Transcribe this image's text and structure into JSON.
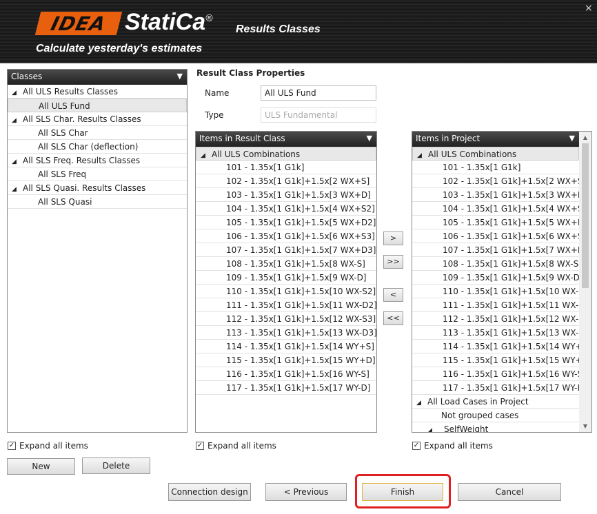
{
  "header": {
    "logo": "IDEA",
    "brand": "StatiCa",
    "reg": "®",
    "subtitle": "Results Classes",
    "tagline": "Calculate yesterday's estimates",
    "close": "×"
  },
  "classes": {
    "title": "Classes",
    "items": [
      {
        "label": "All ULS Results Classes",
        "group": true
      },
      {
        "label": "All ULS Fund",
        "group": false,
        "selected": true
      },
      {
        "label": "All SLS Char. Results Classes",
        "group": true
      },
      {
        "label": "All SLS Char",
        "group": false
      },
      {
        "label": "All SLS Char (deflection)",
        "group": false
      },
      {
        "label": "All SLS Freq. Results Classes",
        "group": true
      },
      {
        "label": "All SLS Freq",
        "group": false
      },
      {
        "label": "All SLS Quasi. Results Classes",
        "group": true
      },
      {
        "label": "All SLS Quasi",
        "group": false
      }
    ]
  },
  "properties": {
    "title": "Result Class Properties",
    "name_label": "Name",
    "name_value": "All ULS Fund",
    "type_label": "Type",
    "type_value": "ULS Fundamental"
  },
  "in_class": {
    "title": "Items in Result Class",
    "group": "All ULS Combinations"
  },
  "in_project": {
    "title": "Items in Project",
    "group": "All ULS Combinations",
    "group2": "All Load Cases in Project",
    "not_grouped": "Not grouped cases",
    "selfweight": "SelfWeight"
  },
  "combinations": [
    "101 - 1.35x[1 G1k]",
    "102 - 1.35x[1 G1k]+1.5x[2 WX+S]",
    "103 - 1.35x[1 G1k]+1.5x[3 WX+D]",
    "104 - 1.35x[1 G1k]+1.5x[4 WX+S2]",
    "105 - 1.35x[1 G1k]+1.5x[5 WX+D2]",
    "106 - 1.35x[1 G1k]+1.5x[6 WX+S3]",
    "107 - 1.35x[1 G1k]+1.5x[7 WX+D3]",
    "108 - 1.35x[1 G1k]+1.5x[8 WX-S]",
    "109 - 1.35x[1 G1k]+1.5x[9 WX-D]",
    "110 - 1.35x[1 G1k]+1.5x[10 WX-S2]",
    "111 - 1.35x[1 G1k]+1.5x[11 WX-D2]",
    "112 - 1.35x[1 G1k]+1.5x[12 WX-S3]",
    "113 - 1.35x[1 G1k]+1.5x[13 WX-D3]",
    "114 - 1.35x[1 G1k]+1.5x[14 WY+S]",
    "115 - 1.35x[1 G1k]+1.5x[15 WY+D]",
    "116 - 1.35x[1 G1k]+1.5x[16 WY-S]",
    "117 - 1.35x[1 G1k]+1.5x[17 WY-D]"
  ],
  "transfer": {
    "add": ">",
    "add_all": ">>",
    "remove": "<",
    "remove_all": "<<"
  },
  "expand_all": "Expand all items",
  "buttons": {
    "new": "New",
    "delete": "Delete",
    "connection": "Connection design",
    "previous": "< Previous",
    "finish": "Finish",
    "cancel": "Cancel"
  },
  "colors": {
    "accent": "#e8600e",
    "highlight": "#e02020"
  }
}
